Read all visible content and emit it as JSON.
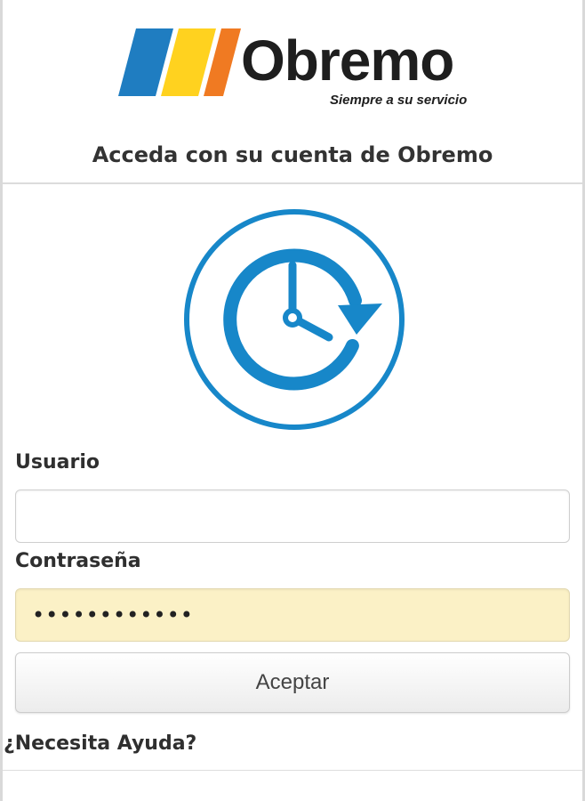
{
  "brand": {
    "name": "Obremo",
    "tagline": "Siempre a su servicio",
    "stripe_colors": [
      "#1f7dc1",
      "#ffd21f",
      "#f07a22"
    ]
  },
  "login": {
    "heading": "Acceda con su cuenta de Obremo",
    "icon": "clock-refresh-icon",
    "accent_color": "#1787c9",
    "username_label": "Usuario",
    "username_value": "",
    "password_label": "Contraseña",
    "password_value": "••••••••••••",
    "submit_label": "Aceptar",
    "help_link": "¿Necesita Ayuda?"
  }
}
